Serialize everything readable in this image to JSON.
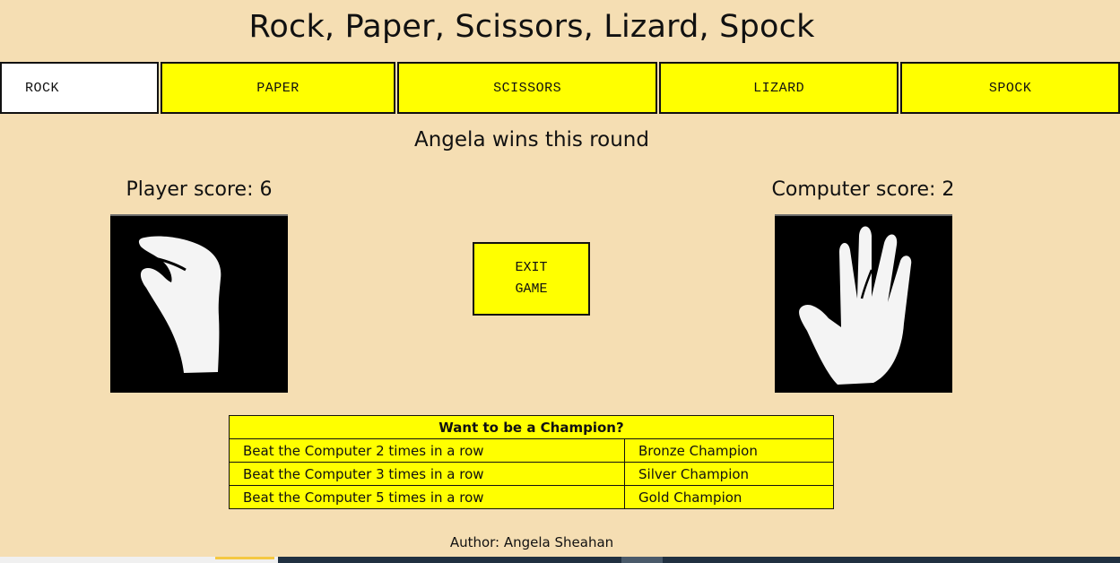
{
  "title": "Rock, Paper, Scissors, Lizard, Spock",
  "choices": [
    {
      "label": "ROCK",
      "selected": true
    },
    {
      "label": "PAPER",
      "selected": false
    },
    {
      "label": "SCISSORS",
      "selected": false
    },
    {
      "label": "LIZARD",
      "selected": false
    },
    {
      "label": "SPOCK",
      "selected": false
    }
  ],
  "round_result": "Angela wins this round",
  "player": {
    "score_label": "Player score: 6",
    "hand_icon": "lizard-hand-icon"
  },
  "computer": {
    "score_label": "Computer score: 2",
    "hand_icon": "spock-hand-icon"
  },
  "exit_button": {
    "line1": "EXIT",
    "line2": "GAME"
  },
  "champion_table": {
    "header": "Want to be a Champion?",
    "rows": [
      {
        "challenge": "Beat the Computer 2 times in a row",
        "award": "Bronze Champion"
      },
      {
        "challenge": "Beat the Computer 3 times in a row",
        "award": "Silver Champion"
      },
      {
        "challenge": "Beat the Computer 5 times in a row",
        "award": "Gold Champion"
      }
    ]
  },
  "footer": {
    "author": "Author: Angela Sheahan"
  },
  "colors": {
    "background": "#f5deb3",
    "button": "#ffff00",
    "selected": "#ffffff"
  }
}
